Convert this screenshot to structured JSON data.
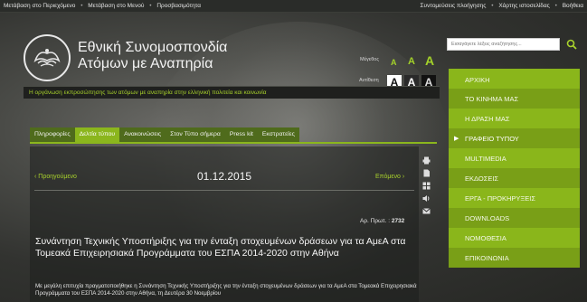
{
  "topbar": {
    "left_links": [
      "Μετάβαση στο Περιεχόμενο",
      "Μετάβαση στο Μενού",
      "Προσβασιμότητα"
    ],
    "right_links": [
      "Συντομεύσεις πλοήγησης",
      "Χάρτης ιστοσελίδας",
      "Βοήθεια"
    ]
  },
  "header": {
    "title_line1": "Εθνική Συνομοσπονδία",
    "title_line2": "Ατόμων με Αναπηρία",
    "font_size_label": "Μέγεθος",
    "contrast_label": "Αντίθεση",
    "font_size_options": [
      "A",
      "A",
      "A"
    ],
    "contrast_options": [
      "A",
      "A",
      "A"
    ],
    "tagline": "Η οργάνωση εκπροσώπησης των ατόμων με αναπηρία στην ελληνική πολιτεία και κοινωνία"
  },
  "search": {
    "placeholder": "Εισαγάγετε λέξεις αναζήτησης..."
  },
  "menu": {
    "items": [
      "ΑΡΧΙΚΗ",
      "ΤΟ ΚΙΝΗΜΑ ΜΑΣ",
      "Η ΔΡΑΣΗ ΜΑΣ",
      "ΓΡΑΦΕΙΟ ΤΥΠΟΥ",
      "MULTIMEDIA",
      "ΕΚΔΟΣΕΙΣ",
      "ΕΡΓΑ - ΠΡΟΚΗΡΥΞΕΙΣ",
      "DOWNLOADS",
      "ΝΟΜΟΘΕΣΙΑ",
      "ΕΠΙΚΟΙΝΩΝΙΑ"
    ],
    "active_index": 3
  },
  "tabs": {
    "items": [
      "Πληροφορίες",
      "Δελτία τύπου",
      "Ανακοινώσεις",
      "Στον Τύπο σήμερα",
      "Press kit",
      "Εκστρατείες"
    ],
    "active_index": 1
  },
  "article": {
    "prev_label": "‹ Προηγούμενο",
    "next_label": "Επόμενο ›",
    "date": "01.12.2015",
    "protocol_label": "Αρ. Πρωτ. :",
    "protocol_number": "2732",
    "title": "Συνάντηση Τεχνικής Υποστήριξης για την ένταξη στοχευμένων δράσεων για τα ΑμεΑ στα Τομεακά Επιχειρησιακά Προγράμματα του ΕΣΠΑ 2014-2020 στην Αθήνα",
    "body": "Με μεγάλη επιτυχία πραγματοποιήθηκε η Συνάντηση Τεχνικής Υποστήριξης για την ένταξη στοχευμένων δράσεων για τα ΑμεΑ στα Τομεακά Επιχειρησιακά Προγράμματα του ΕΣΠΑ 2014-2020 στην Αθήνα, τη Δευτέρα 30 Νοεμβρίου"
  },
  "colors": {
    "accent_green": "#8bb61d",
    "dark_bg": "#2b2d2a",
    "link_green": "#a8d12c"
  },
  "icons": [
    "print-icon",
    "pdf-icon",
    "share-icon",
    "audio-icon",
    "email-icon",
    "search-icon"
  ]
}
